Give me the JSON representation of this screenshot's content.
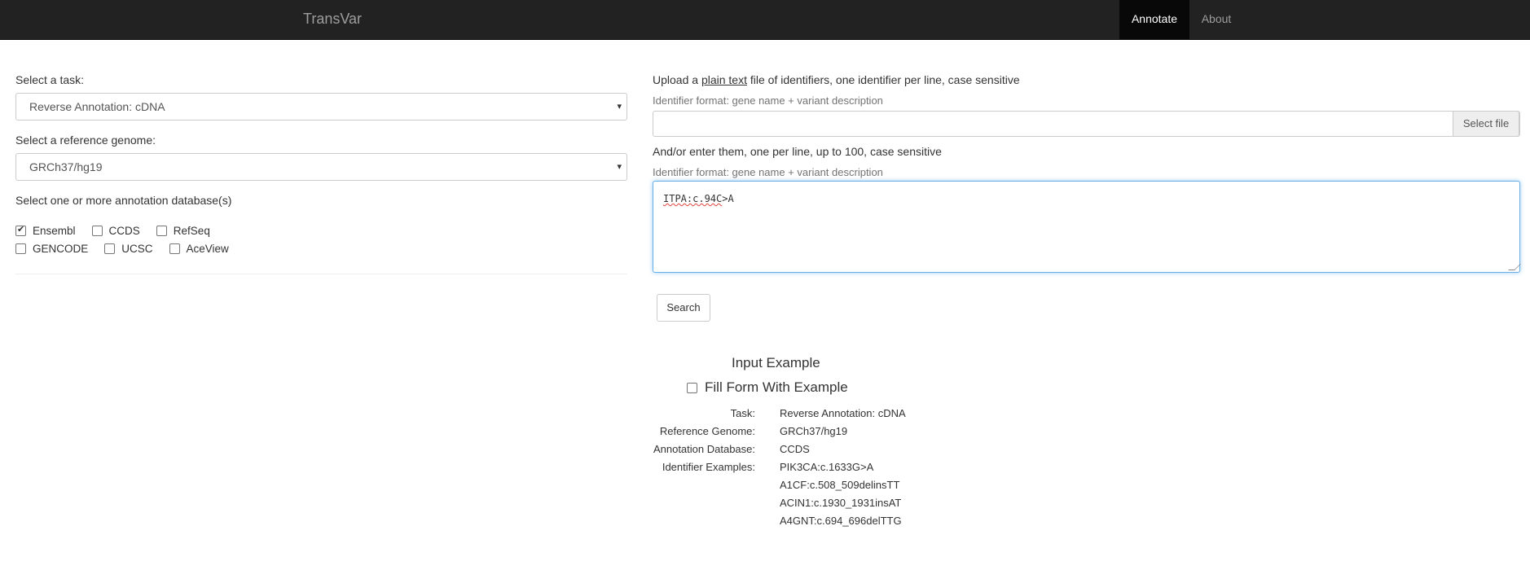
{
  "navbar": {
    "brand": "TransVar",
    "items": [
      {
        "label": "Annotate"
      },
      {
        "label": "About"
      }
    ]
  },
  "task": {
    "label": "Select a task:",
    "selected": "Reverse Annotation: cDNA"
  },
  "genome": {
    "label": "Select a reference genome:",
    "selected": "GRCh37/hg19"
  },
  "databases": {
    "label": "Select one or more annotation database(s)",
    "options": [
      {
        "label": "Ensembl",
        "checked": true
      },
      {
        "label": "CCDS",
        "checked": false
      },
      {
        "label": "RefSeq",
        "checked": false
      },
      {
        "label": "GENCODE",
        "checked": false
      },
      {
        "label": "UCSC",
        "checked": false
      },
      {
        "label": "AceView",
        "checked": false
      }
    ]
  },
  "upload": {
    "prefix": "Upload a ",
    "link": "plain text",
    "suffix": " file of identifiers, one identifier per line, case sensitive",
    "help": "Identifier format: gene name + variant description",
    "button": "Select file"
  },
  "enter": {
    "label": "And/or enter them, one per line, up to 100, case sensitive",
    "help": "Identifier format: gene name + variant description",
    "value_a": "ITPA:c.94C",
    "value_b": ">A"
  },
  "search_button": "Search",
  "example": {
    "title": "Input Example",
    "fill_label": "Fill Form With Example",
    "task_key": "Task:",
    "task_val": "Reverse Annotation: cDNA",
    "genome_key": "Reference Genome:",
    "genome_val": "GRCh37/hg19",
    "db_key": "Annotation Database:",
    "db_val": "CCDS",
    "ids_key": "Identifier Examples:",
    "ids": [
      "PIK3CA:c.1633G>A",
      "A1CF:c.508_509delinsTT",
      "ACIN1:c.1930_1931insAT",
      "A4GNT:c.694_696delTTG"
    ]
  }
}
